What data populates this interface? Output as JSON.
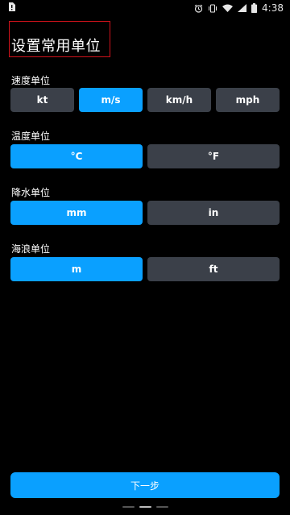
{
  "status_bar": {
    "left_icon": "sim-card-alert-icon",
    "icons": [
      "alarm-icon",
      "vibrate-icon",
      "wifi-icon",
      "signal-icon",
      "battery-icon"
    ],
    "time": "4:38"
  },
  "page": {
    "title": "设置常用单位"
  },
  "sections": {
    "speed": {
      "label": "速度单位",
      "options": [
        "kt",
        "m/s",
        "km/h",
        "mph"
      ],
      "selected": "m/s"
    },
    "temperature": {
      "label": "温度单位",
      "options": [
        "°C",
        "°F"
      ],
      "selected": "°C"
    },
    "precipitation": {
      "label": "降水单位",
      "options": [
        "mm",
        "in"
      ],
      "selected": "mm"
    },
    "wave": {
      "label": "海浪单位",
      "options": [
        "m",
        "ft"
      ],
      "selected": "m"
    }
  },
  "actions": {
    "next_label": "下一步"
  },
  "colors": {
    "accent": "#0aa0ff",
    "unselected": "#3b4049",
    "background": "#000000",
    "highlight_frame": "#d0121b"
  }
}
